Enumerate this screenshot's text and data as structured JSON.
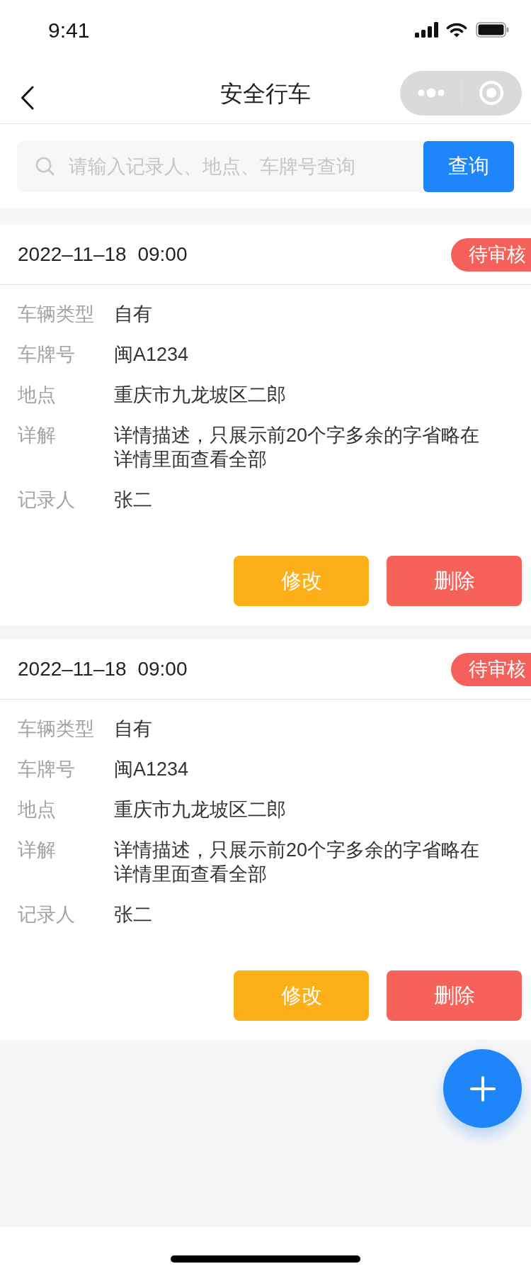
{
  "status_bar": {
    "time": "9:41"
  },
  "nav": {
    "title": "安全行车"
  },
  "search": {
    "placeholder": "请输入记录人、地点、车牌号查询",
    "button": "查询"
  },
  "records": [
    {
      "datetime": "2022–11–18 09:00",
      "status": "待审核",
      "fields": [
        {
          "label": "车辆类型",
          "value": "自有"
        },
        {
          "label": "车牌号",
          "value": "闽A1234"
        },
        {
          "label": "地点",
          "value": "重庆市九龙坡区二郎"
        },
        {
          "label": "详解",
          "value": "详情描述，只展示前20个字多余的字省略在详情里面查看全部"
        },
        {
          "label": "记录人",
          "value": "张二"
        }
      ],
      "actions": [
        {
          "label": "修改",
          "kind": "edit"
        },
        {
          "label": "删除",
          "kind": "delete"
        }
      ]
    },
    {
      "datetime": "2022–11–18 09:00",
      "status": "待审核",
      "fields": [
        {
          "label": "车辆类型",
          "value": "自有"
        },
        {
          "label": "车牌号",
          "value": "闽A1234"
        },
        {
          "label": "地点",
          "value": "重庆市九龙坡区二郎"
        },
        {
          "label": "详解",
          "value": "详情描述，只展示前20个字多余的字省略在详情里面查看全部"
        },
        {
          "label": "记录人",
          "value": "张二"
        }
      ],
      "actions": [
        {
          "label": "修改",
          "kind": "edit"
        },
        {
          "label": "删除",
          "kind": "delete"
        }
      ]
    }
  ]
}
